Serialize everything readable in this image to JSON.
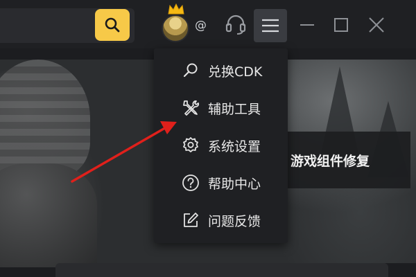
{
  "toolbar": {
    "search_icon": "search-icon",
    "user_suffix": "@",
    "headset_icon": "headset-icon",
    "menu_icon": "hamburger-menu-icon",
    "minimize_icon": "minimize-icon",
    "maximize_icon": "maximize-icon",
    "close_icon": "close-icon",
    "accent_color": "#f7c948"
  },
  "menu": {
    "items": [
      {
        "label": "兑换CDK",
        "icon": "search-icon"
      },
      {
        "label": "辅助工具",
        "icon": "tools-icon"
      },
      {
        "label": "系统设置",
        "icon": "gear-icon"
      },
      {
        "label": "帮助中心",
        "icon": "help-circle-icon"
      },
      {
        "label": "问题反馈",
        "icon": "edit-icon"
      }
    ]
  },
  "side_panel": {
    "label": "游戏组件修复"
  },
  "annotation": {
    "arrow_color": "#e0201b"
  }
}
